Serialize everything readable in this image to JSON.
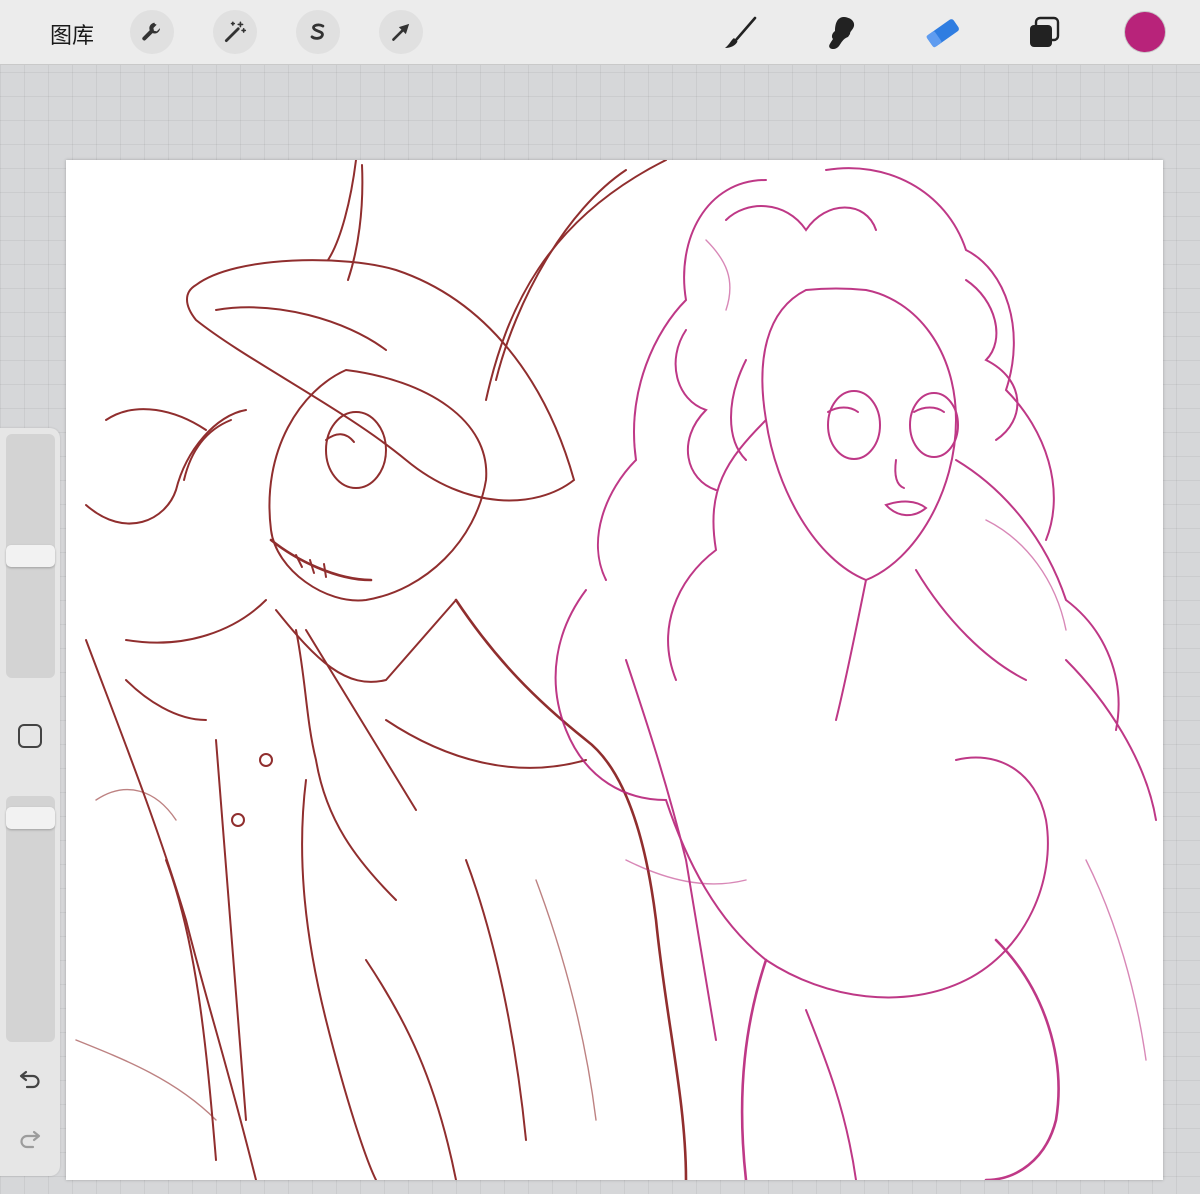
{
  "toolbar": {
    "gallery_label": "图库",
    "left_tools": [
      {
        "name": "actions",
        "icon": "wrench-icon"
      },
      {
        "name": "adjustments",
        "icon": "magic-wand-icon"
      },
      {
        "name": "selection",
        "icon": "selection-s-icon"
      },
      {
        "name": "transform",
        "icon": "arrow-cursor-icon"
      }
    ],
    "right_tools": [
      {
        "name": "brush",
        "icon": "brush-icon"
      },
      {
        "name": "smudge",
        "icon": "smudge-icon"
      },
      {
        "name": "eraser",
        "icon": "eraser-icon",
        "active": true
      },
      {
        "name": "layers",
        "icon": "layers-icon"
      }
    ],
    "current_color": "#b8237a"
  },
  "colors": {
    "eraser_active": "#2f7de1",
    "sketch_left": "#8b2323",
    "sketch_right": "#b8237a"
  },
  "sidebar": {
    "brush_size_level": 0.5,
    "opacity_level": 0.95,
    "icons": [
      "modify-square-icon",
      "undo-icon",
      "redo-icon"
    ]
  }
}
